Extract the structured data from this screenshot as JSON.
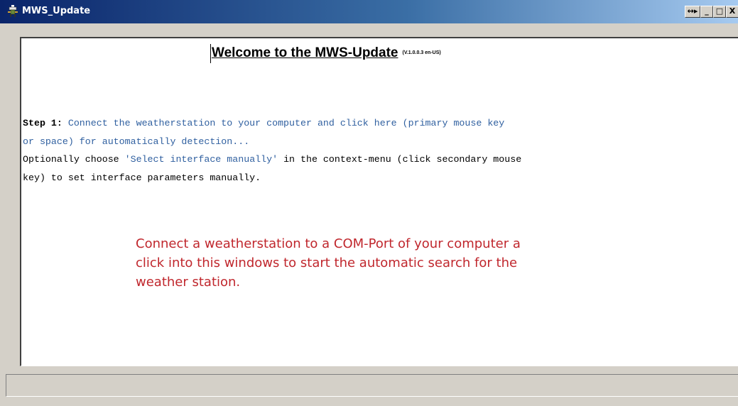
{
  "window": {
    "title": "MWS_Update",
    "icon": "weatherstation-app-icon",
    "buttons": {
      "dock": "↔▸",
      "minimize": "_",
      "maximize": "□",
      "close": "X"
    }
  },
  "content": {
    "welcome_title": "Welcome to the MWS-Update",
    "version": "(V.1.0.0.3 en-US)",
    "step1_label": "Step 1:",
    "step1_line1": "Connect the weatherstation to your computer and click here (primary mouse key",
    "step1_line2": "or space) for automatically detection...",
    "optional_prefix": "Optionally choose ",
    "optional_highlight": "'Select interface manually'",
    "optional_suffix": " in the context-menu (click secondary mouse",
    "optional_line2": "key) to set interface parameters manually."
  },
  "annotation": {
    "line1": "Connect a weatherstation to a COM-Port of your computer a",
    "line2": "click into this windows to start the automatic search for the",
    "line3": "weather station."
  },
  "statusbar": {
    "text": ""
  },
  "colors": {
    "titlebar_start": "#0a246a",
    "titlebar_end": "#a6caf0",
    "link_blue": "#3060a0",
    "annotation_red": "#c0272d",
    "face": "#d4d0c8"
  }
}
